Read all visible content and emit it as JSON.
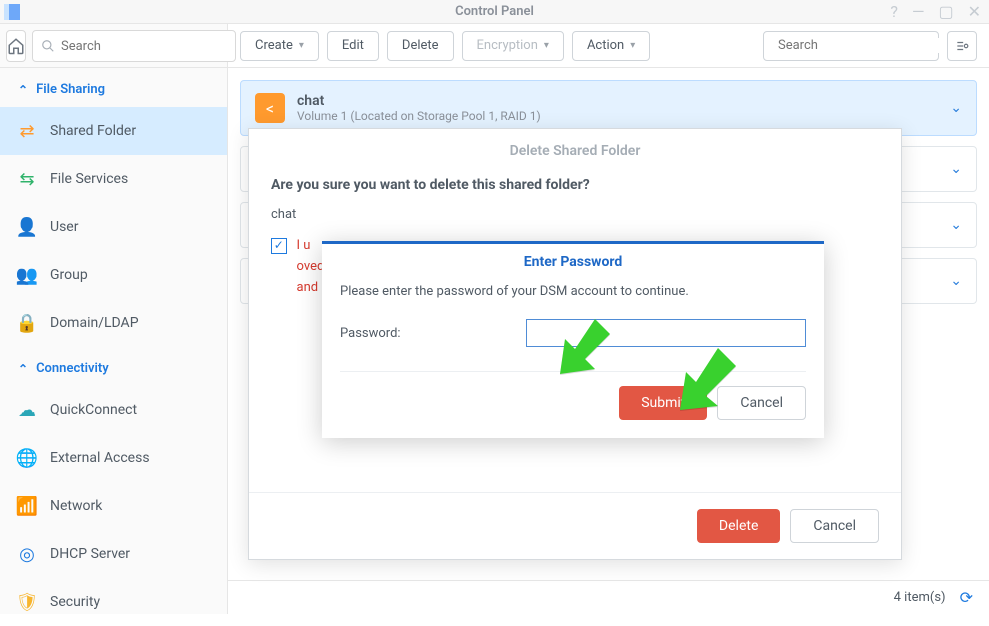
{
  "titlebar": {
    "title": "Control Panel"
  },
  "sidebar": {
    "search_placeholder": "Search",
    "groups": [
      {
        "label": "File Sharing",
        "items": [
          {
            "label": "Shared Folder",
            "active": true,
            "icon_bg": "#ff9a2e",
            "glyph": "⇄"
          },
          {
            "label": "File Services",
            "active": false,
            "icon_bg": "#2fb36a",
            "glyph": "⇆"
          },
          {
            "label": "User",
            "active": false,
            "icon_bg": "#f0a04b",
            "glyph": "👤"
          },
          {
            "label": "Group",
            "active": false,
            "icon_bg": "#f06b4b",
            "glyph": "👥"
          },
          {
            "label": "Domain/LDAP",
            "active": false,
            "icon_bg": "#1e7adf",
            "glyph": "🔒"
          }
        ]
      },
      {
        "label": "Connectivity",
        "items": [
          {
            "label": "QuickConnect",
            "active": false,
            "icon_bg": "#2aa6b7",
            "glyph": "☁"
          },
          {
            "label": "External Access",
            "active": false,
            "icon_bg": "#1e7adf",
            "glyph": "🌐"
          },
          {
            "label": "Network",
            "active": false,
            "icon_bg": "#e25a9a",
            "glyph": "📶"
          },
          {
            "label": "DHCP Server",
            "active": false,
            "icon_bg": "#1e7adf",
            "glyph": "◎"
          },
          {
            "label": "Security",
            "active": false,
            "icon_bg": "#f7b52e",
            "glyph": "🛡"
          }
        ]
      }
    ]
  },
  "toolbar": {
    "create": "Create",
    "edit": "Edit",
    "delete": "Delete",
    "encryption": "Encryption",
    "action": "Action",
    "search_placeholder": "Search"
  },
  "folders": {
    "selected_name": "chat",
    "selected_sub": "Volume 1 (Located on Storage Pool 1, RAID 1)"
  },
  "footer": {
    "count_text": "4 item(s)"
  },
  "dialog_delete": {
    "title": "Delete Shared Folder",
    "question": "Are you sure you want to delete this shared folder?",
    "folder": "chat",
    "ack_prefix": "I u",
    "ack_suffix_1": "oved",
    "ack_suffix_2": "and",
    "delete": "Delete",
    "cancel": "Cancel"
  },
  "dialog_pw": {
    "title": "Enter Password",
    "message": "Please enter the password of your DSM account to continue.",
    "label": "Password:",
    "submit": "Submit",
    "cancel": "Cancel"
  }
}
